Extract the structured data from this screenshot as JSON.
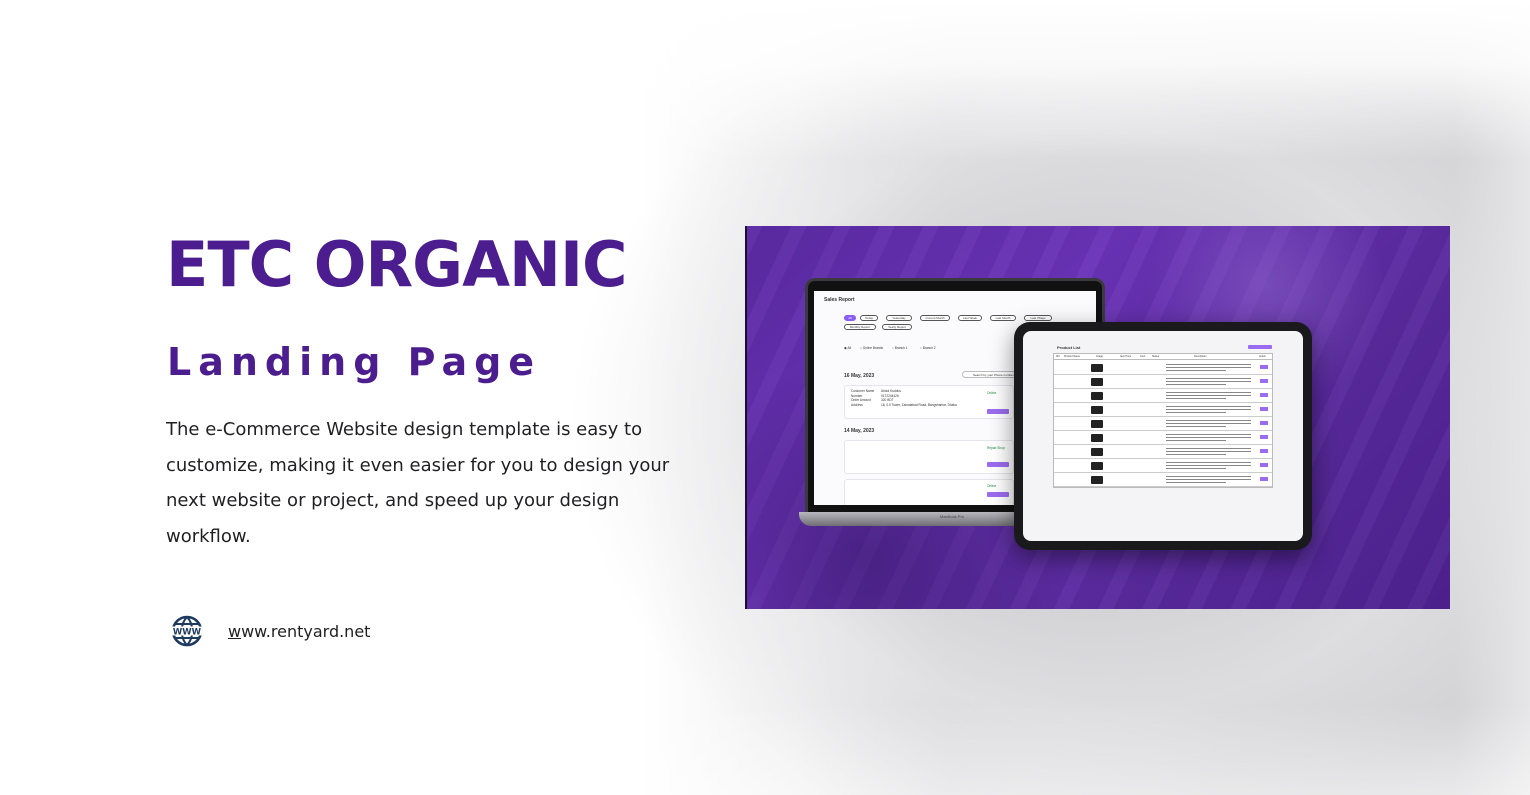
{
  "brand": {
    "title": "ETC ORGANIC",
    "subtitle": "Landing Page",
    "description": "The e-Commerce Website design template is easy to customize, making it even easier for you to design your next website or project, and speed up your design workflow.",
    "website": "www.rentyard.net",
    "icon": "globe-www-icon",
    "color": "#4b1d8f"
  },
  "hero": {
    "background_color": "#5b2aa3",
    "laptop": {
      "screen_title": "Sales Report",
      "filters": [
        "All",
        "Today",
        "Yesterday",
        "Current Month",
        "Last Week",
        "Last Month",
        "Last 7Days",
        "Monthly Report",
        "Yearly Report"
      ],
      "radio_options": [
        "All",
        "Online Brands",
        "Branch 1",
        "Branch 2"
      ],
      "search_placeholder": "Search by your Phone number",
      "dates": [
        "16 May, 2023",
        "14 May, 2023"
      ],
      "order_fields": [
        "Customer Name",
        "Number",
        "Order Amount",
        "Address"
      ],
      "order_values": [
        "Abdul Kuddus",
        "0172244426",
        "320 BDT",
        "18, 0.0 Tower, Zamalabad Road, Bangshamar, Dhaka"
      ],
      "status_labels": [
        "Online",
        "Repair Shop",
        "Online"
      ],
      "brand_label": "MacBook Pro"
    },
    "tablet": {
      "screen_title": "Product List",
      "columns": [
        "SN",
        "Product Name",
        "Image",
        "Item Price",
        "Cost",
        "Status",
        "Description",
        "Action"
      ]
    }
  }
}
